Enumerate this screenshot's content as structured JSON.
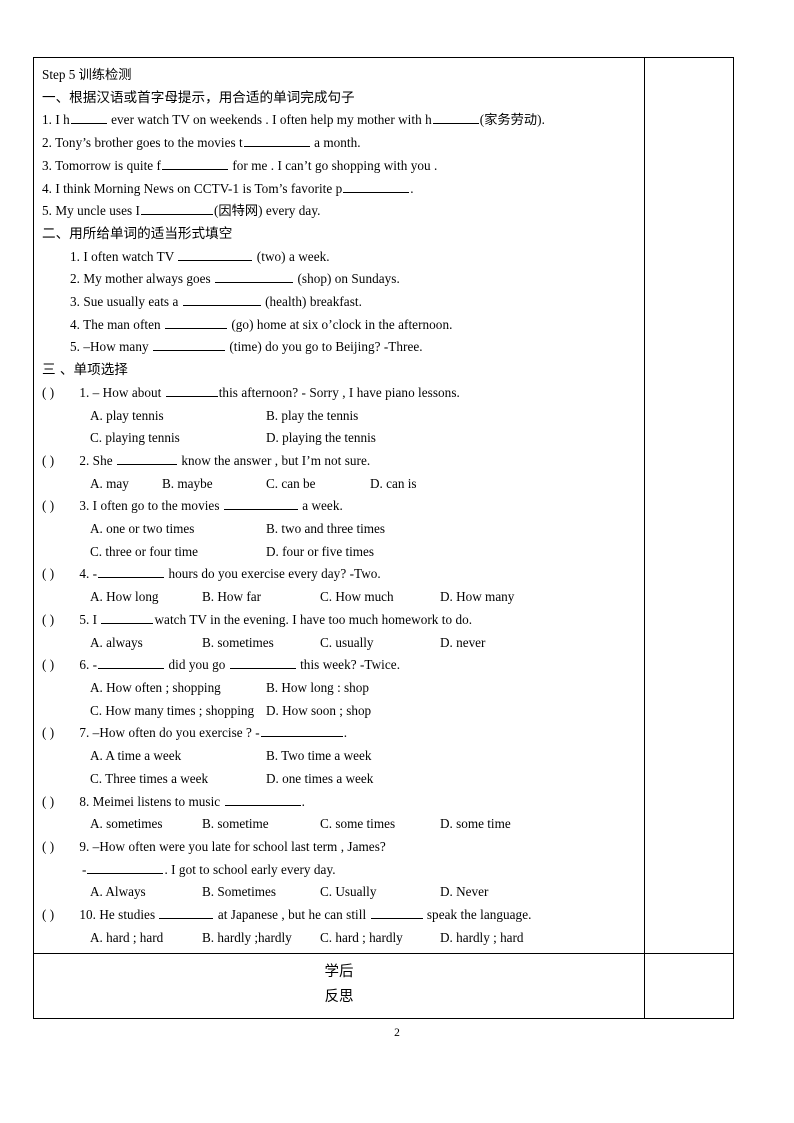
{
  "page": {
    "number": "2"
  },
  "worksheet": {
    "step_title": "Step 5  训练检测",
    "sections": [
      {
        "id": "section-one",
        "heading": "一、根据汉语或首字母提示，用合适的单词完成句子",
        "items": [
          {
            "num": "1.",
            "pre": "I h",
            "b1": "36px",
            "mid": " ever watch TV on weekends . I often help my mother with h",
            "b2": "46px",
            "post": "(家务劳动)."
          },
          {
            "num": "2.",
            "pre": "Tony’s brother goes to the movies t",
            "b1": "66px",
            "mid": " a month.",
            "b2": "",
            "post": ""
          },
          {
            "num": "3.",
            "pre": "Tomorrow is quite f",
            "b1": "66px",
            "mid": " for me . I can’t go shopping with you .",
            "b2": "",
            "post": ""
          },
          {
            "num": "4.",
            "pre": "I think Morning News on CCTV-1 is Tom’s favorite p",
            "b1": "66px",
            "mid": ".",
            "b2": "",
            "post": ""
          },
          {
            "num": "5.",
            "pre": "My uncle uses I",
            "b1": "72px",
            "mid": "(因特网) every day.",
            "b2": "",
            "post": ""
          }
        ]
      },
      {
        "id": "section-two",
        "heading": "二、用所给单词的适当形式填空",
        "items": [
          {
            "num": "1.",
            "pre": "I often watch TV ",
            "b1": "74px",
            "mid": " (two) a week.",
            "b2": "",
            "post": ""
          },
          {
            "num": "2.",
            "pre": "My mother always goes ",
            "b1": "78px",
            "mid": " (shop) on Sundays.",
            "b2": "",
            "post": ""
          },
          {
            "num": "3.",
            "pre": "Sue usually eats a ",
            "b1": "78px",
            "mid": " (health) breakfast.",
            "b2": "",
            "post": ""
          },
          {
            "num": "4.",
            "pre": "The man often ",
            "b1": "62px",
            "mid": " (go) home at six o’clock in the afternoon.",
            "b2": "",
            "post": ""
          },
          {
            "num": "5.",
            "pre": "–How many ",
            "b1": "72px",
            "mid": " (time) do you go to Beijing?        -Three.",
            "b2": "",
            "post": ""
          }
        ]
      },
      {
        "id": "section-three",
        "heading": "三 、单项选择",
        "questions": [
          {
            "num": "1.",
            "stem_pre": "– How about ",
            "blank": "52px",
            "stem_post": "this afternoon?    - Sorry , I have piano lessons.",
            "stem2": "",
            "layout": "2x2",
            "options": [
              "A. play tennis",
              "B. play the tennis",
              "C. playing tennis",
              "D. playing the tennis"
            ]
          },
          {
            "num": "2.",
            "stem_pre": "She ",
            "blank": "60px",
            "stem_post": " know the answer , but I’m not sure.",
            "stem2": "",
            "layout": "1x4-tight",
            "options": [
              "A. may",
              "B. maybe",
              "C. can be",
              "D. can is"
            ]
          },
          {
            "num": "3.",
            "stem_pre": "I often go to the movies ",
            "blank": "74px",
            "stem_post": " a week.",
            "stem2": "",
            "layout": "2x2",
            "options": [
              "A. one or two times",
              "B. two and three times",
              "C. three or four time",
              "D. four or five times"
            ]
          },
          {
            "num": "4.",
            "stem_pre": "-",
            "blank": "66px",
            "stem_post": " hours do you exercise every day?            -Two.",
            "stem2": "",
            "layout": "1x4",
            "options": [
              "A. How long",
              "B. How far",
              "C. How much",
              "D. How many"
            ]
          },
          {
            "num": "5.",
            "stem_pre": "I ",
            "blank": "52px",
            "stem_post": "watch TV in the evening. I have too much homework to do.",
            "stem2": "",
            "layout": "1x4",
            "options": [
              "A. always",
              "B. sometimes",
              "C. usually",
              "D. never"
            ]
          },
          {
            "num": "6.",
            "stem_pre": "-",
            "blank": "66px",
            "stem_post": " did you go ",
            "blank2": "66px",
            "stem_post2": " this week?        -Twice.",
            "stem2": "",
            "layout": "2x2",
            "options": [
              "A. How often ; shopping",
              "B. How long : shop",
              "C. How many times ; shopping",
              "D. How soon ; shop"
            ]
          },
          {
            "num": "7.",
            "stem_pre": "–How often do you exercise ?       -",
            "blank": "82px",
            "stem_post": ".",
            "stem2": "",
            "layout": "2x2",
            "options": [
              "A. A time a week",
              "B. Two time a week",
              "C. Three times a week",
              "D. one times a week"
            ]
          },
          {
            "num": "8.",
            "stem_pre": "Meimei listens to music ",
            "blank": "76px",
            "stem_post": ".",
            "stem2": "",
            "layout": "1x4",
            "options": [
              "A. sometimes",
              "B. sometime",
              "C. some times",
              "D. some time"
            ]
          },
          {
            "num": "9.",
            "stem_pre": "–How often were you late for school last term , James?",
            "blank": "",
            "stem_post": "",
            "stem2_pre": "-",
            "stem2_blank": "76px",
            "stem2_post": ". I got to school early every day.",
            "layout": "1x4",
            "options": [
              "A. Always",
              "B. Sometimes",
              "C. Usually",
              "D. Never"
            ]
          },
          {
            "num": "10.",
            "stem_pre": "He studies ",
            "blank": "54px",
            "stem_post": " at Japanese , but he can still ",
            "blank2": "52px",
            "stem_post2": " speak the language.",
            "stem2": "",
            "layout": "1x4",
            "options": [
              "A. hard ; hard",
              "B. hardly ;hardly",
              "C. hard ; hardly",
              "D. hardly ; hard"
            ]
          }
        ]
      }
    ],
    "reflection": {
      "label_line1": "学后",
      "label_line2": "反思",
      "body": ""
    }
  }
}
